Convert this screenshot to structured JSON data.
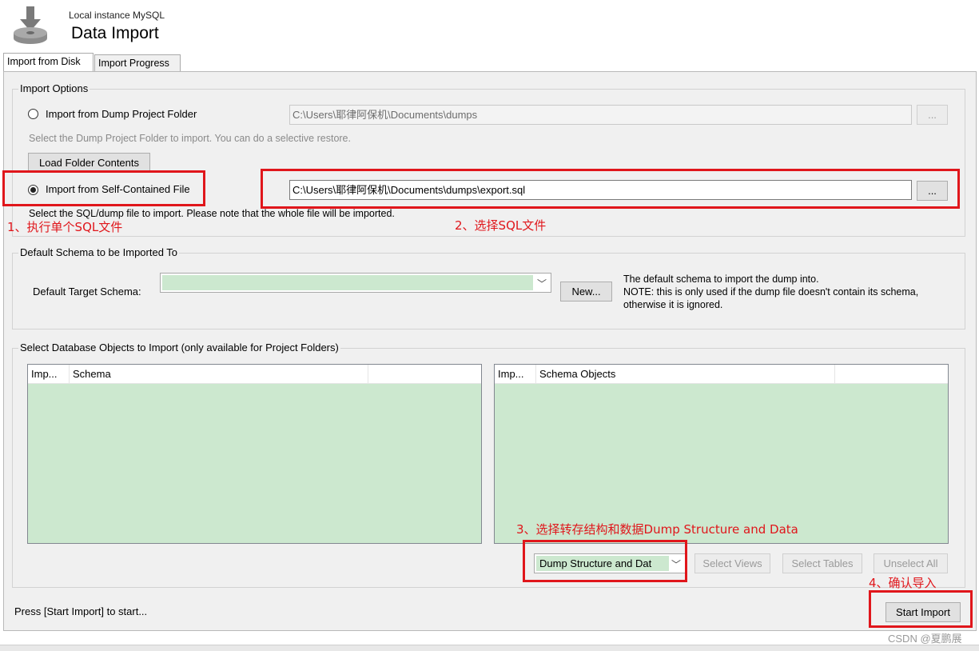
{
  "header": {
    "subtitle": "Local instance MySQL",
    "title": "Data Import",
    "icon": "download-disk-icon"
  },
  "tabs": [
    {
      "label": "Import from Disk",
      "active": true
    },
    {
      "label": "Import Progress",
      "active": false
    }
  ],
  "import_options": {
    "group_label": "Import Options",
    "dump_folder": {
      "label": "Import from Dump Project Folder",
      "path": "C:\\Users\\耶律阿保机\\Documents\\dumps",
      "browse": "...",
      "hint": "Select the Dump Project Folder to import. You can do a selective restore.",
      "load_button": "Load Folder Contents",
      "selected": false
    },
    "self_contained": {
      "label": "Import from Self-Contained File",
      "path": "C:\\Users\\耶律阿保机\\Documents\\dumps\\export.sql",
      "browse": "...",
      "hint": "Select the SQL/dump file to import. Please note that the whole file will be imported.",
      "selected": true
    }
  },
  "default_schema": {
    "group_label": "Default Schema to be Imported To",
    "field_label": "Default Target Schema:",
    "value": "",
    "new_button": "New...",
    "note_line1": "The default schema to import the dump into.",
    "note_line2": "NOTE: this is only used if the dump file doesn't contain its schema,",
    "note_line3": "otherwise it is ignored."
  },
  "objects": {
    "group_label": "Select Database Objects to Import (only available for Project Folders)",
    "left_table": {
      "col1": "Imp...",
      "col2": "Schema"
    },
    "right_table": {
      "col1": "Imp...",
      "col2": "Schema Objects"
    },
    "dump_select": "Dump Structure and Dat",
    "select_views": "Select Views",
    "select_tables": "Select Tables",
    "unselect_all": "Unselect All"
  },
  "footer": {
    "status": "Press [Start Import] to start...",
    "start_button": "Start Import"
  },
  "annotations": {
    "a1": "1、执行单个SQL文件",
    "a2": "2、选择SQL文件",
    "a3": "3、选择转存结构和数据Dump Structure and Data",
    "a4": "4、确认导入"
  },
  "watermark": "CSDN @夏鹏展",
  "colors": {
    "annotation_red": "#e0161b",
    "list_green": "#cce8cf",
    "panel_bg": "#f0f0f0"
  }
}
